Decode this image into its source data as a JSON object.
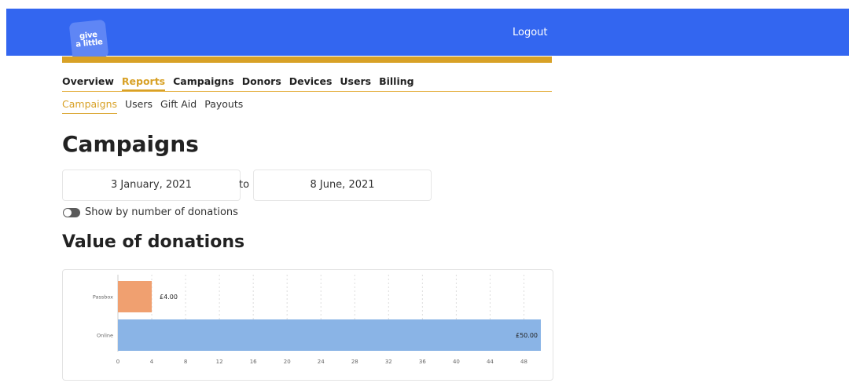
{
  "header": {
    "logo_line1": "give",
    "logo_line2": "a little",
    "logout_label": "Logout",
    "brand_color": "#3366f0",
    "accent_color": "#d8a126"
  },
  "nav": {
    "main": [
      {
        "label": "Overview",
        "active": false
      },
      {
        "label": "Reports",
        "active": true
      },
      {
        "label": "Campaigns",
        "active": false
      },
      {
        "label": "Donors",
        "active": false
      },
      {
        "label": "Devices",
        "active": false
      },
      {
        "label": "Users",
        "active": false
      },
      {
        "label": "Billing",
        "active": false
      }
    ],
    "sub": [
      {
        "label": "Campaigns",
        "active": true
      },
      {
        "label": "Users",
        "active": false
      },
      {
        "label": "Gift Aid",
        "active": false
      },
      {
        "label": "Payouts",
        "active": false
      }
    ]
  },
  "page": {
    "title": "Campaigns",
    "date_from": "3 January, 2021",
    "to_label": "to",
    "date_to": "8 June, 2021",
    "toggle_label": "Show by number of donations",
    "toggle_on": false,
    "section_title": "Value of donations"
  },
  "chart_data": {
    "type": "bar",
    "orientation": "horizontal",
    "categories": [
      "Passbox",
      "Online"
    ],
    "values": [
      4,
      50
    ],
    "value_labels": [
      "£4.00",
      "£50.00"
    ],
    "colors": [
      "#f0a070",
      "#8ab4e6"
    ],
    "xticks": [
      0,
      4,
      8,
      12,
      16,
      20,
      24,
      28,
      32,
      36,
      40,
      44,
      48
    ],
    "xlim": [
      0,
      50
    ],
    "grid": true
  }
}
